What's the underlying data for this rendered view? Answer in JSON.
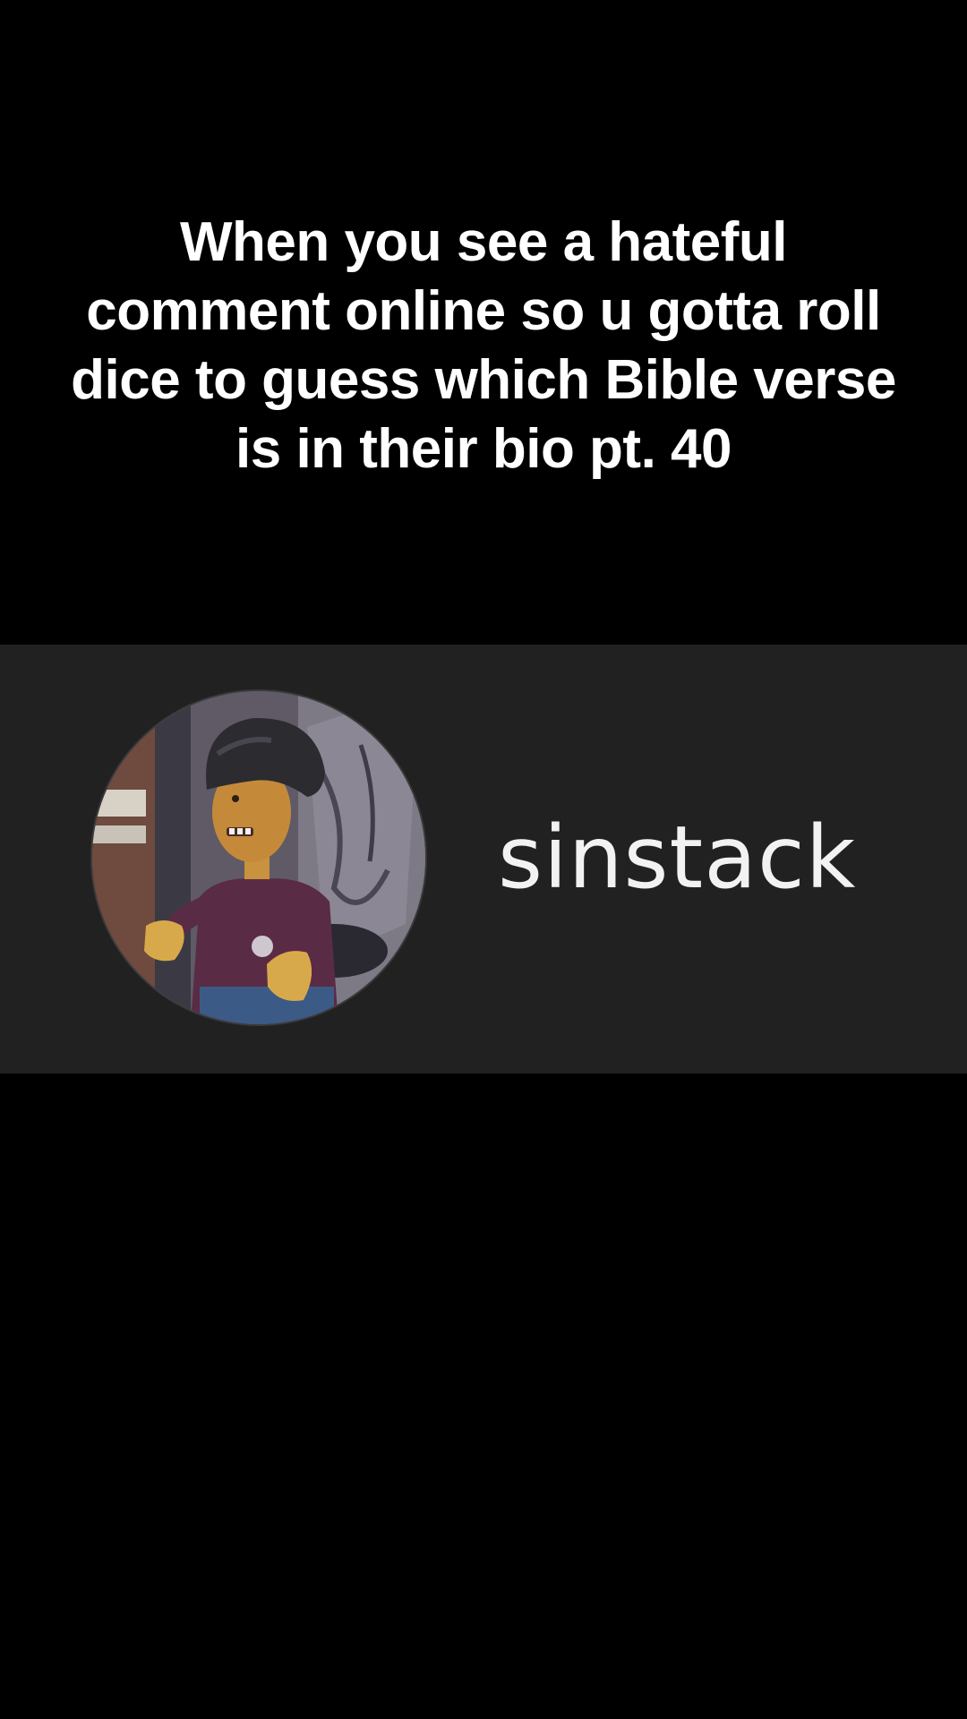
{
  "caption": {
    "text": "When you see a hateful comment online so u gotta roll dice to guess which Bible verse is in their bio pt. 40"
  },
  "profile": {
    "username": "sinstack",
    "avatar_icon": "claymation-character-avatar"
  },
  "colors": {
    "background": "#000000",
    "card_background": "#212121",
    "caption_text": "#ffffff",
    "username_text": "#f2f2f2"
  }
}
